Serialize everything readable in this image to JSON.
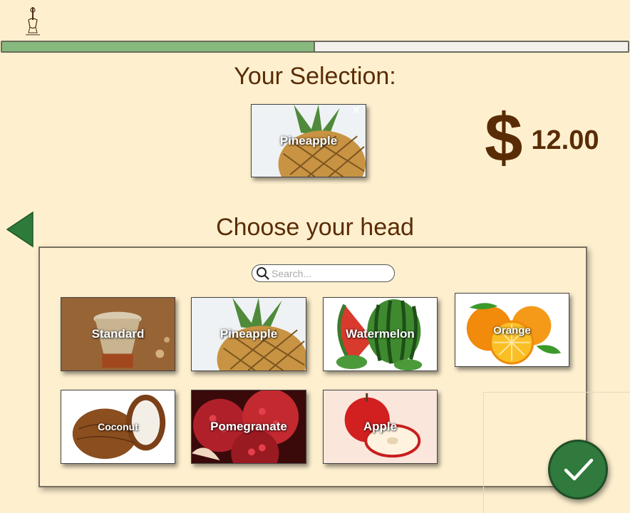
{
  "header": {
    "progress": 0.5
  },
  "selection": {
    "title": "Your Selection:",
    "item": {
      "name": "Pineapple",
      "remove_icon": "close-icon"
    },
    "currency": "$",
    "price": "12.00"
  },
  "chooser": {
    "title": "Choose your head",
    "search": {
      "placeholder": "Search...",
      "value": ""
    },
    "items": [
      {
        "name": "Standard"
      },
      {
        "name": "Pineapple"
      },
      {
        "name": "Watermelon"
      },
      {
        "name": "Orange"
      },
      {
        "name": "Coconut"
      },
      {
        "name": "Pomegranate"
      },
      {
        "name": "Apple"
      }
    ]
  },
  "actions": {
    "back_icon": "back-arrow-icon",
    "confirm_icon": "checkmark-icon"
  },
  "colors": {
    "background": "#fef0cf",
    "text": "#5a2c05",
    "progress": "#86b97d",
    "accent": "#2f7a3c"
  }
}
